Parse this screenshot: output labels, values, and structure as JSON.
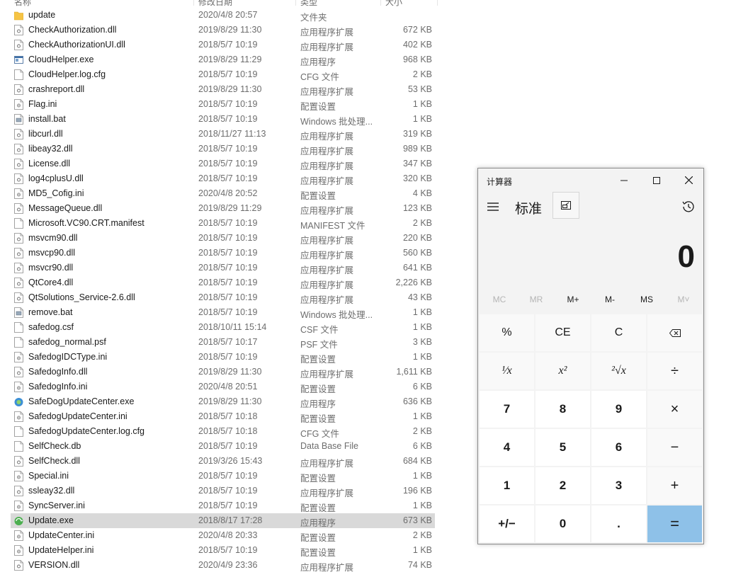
{
  "explorer": {
    "headers": {
      "name": "名称",
      "date": "修改日期",
      "type": "类型",
      "size": "大小"
    },
    "files": [
      {
        "name": "update",
        "date": "2020/4/8 20:57",
        "type": "文件夹",
        "size": "",
        "icon": "folder-icon"
      },
      {
        "name": "CheckAuthorization.dll",
        "date": "2019/8/29 11:30",
        "type": "应用程序扩展",
        "size": "672 KB",
        "icon": "dll-file-icon"
      },
      {
        "name": "CheckAuthorizationUI.dll",
        "date": "2018/5/7 10:19",
        "type": "应用程序扩展",
        "size": "402 KB",
        "icon": "dll-file-icon"
      },
      {
        "name": "CloudHelper.exe",
        "date": "2019/8/29 11:29",
        "type": "应用程序",
        "size": "968 KB",
        "icon": "exe-file-icon"
      },
      {
        "name": "CloudHelper.log.cfg",
        "date": "2018/5/7 10:19",
        "type": "CFG 文件",
        "size": "2 KB",
        "icon": "file-icon"
      },
      {
        "name": "crashreport.dll",
        "date": "2019/8/29 11:30",
        "type": "应用程序扩展",
        "size": "53 KB",
        "icon": "dll-file-icon"
      },
      {
        "name": "Flag.ini",
        "date": "2018/5/7 10:19",
        "type": "配置设置",
        "size": "1 KB",
        "icon": "ini-file-icon"
      },
      {
        "name": "install.bat",
        "date": "2018/5/7 10:19",
        "type": "Windows 批处理...",
        "size": "1 KB",
        "icon": "bat-file-icon"
      },
      {
        "name": "libcurl.dll",
        "date": "2018/11/27 11:13",
        "type": "应用程序扩展",
        "size": "319 KB",
        "icon": "dll-file-icon"
      },
      {
        "name": "libeay32.dll",
        "date": "2018/5/7 10:19",
        "type": "应用程序扩展",
        "size": "989 KB",
        "icon": "dll-file-icon"
      },
      {
        "name": "License.dll",
        "date": "2018/5/7 10:19",
        "type": "应用程序扩展",
        "size": "347 KB",
        "icon": "dll-file-icon"
      },
      {
        "name": "log4cplusU.dll",
        "date": "2018/5/7 10:19",
        "type": "应用程序扩展",
        "size": "320 KB",
        "icon": "dll-file-icon"
      },
      {
        "name": "MD5_Cofig.ini",
        "date": "2020/4/8 20:52",
        "type": "配置设置",
        "size": "4 KB",
        "icon": "ini-file-icon"
      },
      {
        "name": "MessageQueue.dll",
        "date": "2019/8/29 11:29",
        "type": "应用程序扩展",
        "size": "123 KB",
        "icon": "dll-file-icon"
      },
      {
        "name": "Microsoft.VC90.CRT.manifest",
        "date": "2018/5/7 10:19",
        "type": "MANIFEST 文件",
        "size": "2 KB",
        "icon": "file-icon"
      },
      {
        "name": "msvcm90.dll",
        "date": "2018/5/7 10:19",
        "type": "应用程序扩展",
        "size": "220 KB",
        "icon": "dll-file-icon"
      },
      {
        "name": "msvcp90.dll",
        "date": "2018/5/7 10:19",
        "type": "应用程序扩展",
        "size": "560 KB",
        "icon": "dll-file-icon"
      },
      {
        "name": "msvcr90.dll",
        "date": "2018/5/7 10:19",
        "type": "应用程序扩展",
        "size": "641 KB",
        "icon": "dll-file-icon"
      },
      {
        "name": "QtCore4.dll",
        "date": "2018/5/7 10:19",
        "type": "应用程序扩展",
        "size": "2,226 KB",
        "icon": "dll-file-icon"
      },
      {
        "name": "QtSolutions_Service-2.6.dll",
        "date": "2018/5/7 10:19",
        "type": "应用程序扩展",
        "size": "43 KB",
        "icon": "dll-file-icon"
      },
      {
        "name": "remove.bat",
        "date": "2018/5/7 10:19",
        "type": "Windows 批处理...",
        "size": "1 KB",
        "icon": "bat-file-icon"
      },
      {
        "name": "safedog.csf",
        "date": "2018/10/11 15:14",
        "type": "CSF 文件",
        "size": "1 KB",
        "icon": "file-icon"
      },
      {
        "name": "safedog_normal.psf",
        "date": "2018/5/7 10:17",
        "type": "PSF 文件",
        "size": "3 KB",
        "icon": "file-icon"
      },
      {
        "name": "SafedogIDCType.ini",
        "date": "2018/5/7 10:19",
        "type": "配置设置",
        "size": "1 KB",
        "icon": "ini-file-icon"
      },
      {
        "name": "SafedogInfo.dll",
        "date": "2019/8/29 11:30",
        "type": "应用程序扩展",
        "size": "1,611 KB",
        "icon": "dll-file-icon"
      },
      {
        "name": "SafedogInfo.ini",
        "date": "2020/4/8 20:51",
        "type": "配置设置",
        "size": "6 KB",
        "icon": "ini-file-icon"
      },
      {
        "name": "SafeDogUpdateCenter.exe",
        "date": "2019/8/29 11:30",
        "type": "应用程序",
        "size": "636 KB",
        "icon": "safedog-exe-icon"
      },
      {
        "name": "SafedogUpdateCenter.ini",
        "date": "2018/5/7 10:18",
        "type": "配置设置",
        "size": "1 KB",
        "icon": "ini-file-icon"
      },
      {
        "name": "SafedogUpdateCenter.log.cfg",
        "date": "2018/5/7 10:18",
        "type": "CFG 文件",
        "size": "2 KB",
        "icon": "file-icon"
      },
      {
        "name": "SelfCheck.db",
        "date": "2018/5/7 10:19",
        "type": "Data Base File",
        "size": "6 KB",
        "icon": "file-icon"
      },
      {
        "name": "SelfCheck.dll",
        "date": "2019/3/26 15:43",
        "type": "应用程序扩展",
        "size": "684 KB",
        "icon": "dll-file-icon"
      },
      {
        "name": "Special.ini",
        "date": "2018/5/7 10:19",
        "type": "配置设置",
        "size": "1 KB",
        "icon": "ini-file-icon"
      },
      {
        "name": "ssleay32.dll",
        "date": "2018/5/7 10:19",
        "type": "应用程序扩展",
        "size": "196 KB",
        "icon": "dll-file-icon"
      },
      {
        "name": "SyncServer.ini",
        "date": "2018/5/7 10:19",
        "type": "配置设置",
        "size": "1 KB",
        "icon": "ini-file-icon"
      },
      {
        "name": "Update.exe",
        "date": "2018/8/17 17:28",
        "type": "应用程序",
        "size": "673 KB",
        "icon": "update-exe-icon",
        "selected": true
      },
      {
        "name": "UpdateCenter.ini",
        "date": "2020/4/8 20:33",
        "type": "配置设置",
        "size": "2 KB",
        "icon": "ini-file-icon"
      },
      {
        "name": "UpdateHelper.ini",
        "date": "2018/5/7 10:19",
        "type": "配置设置",
        "size": "1 KB",
        "icon": "ini-file-icon"
      },
      {
        "name": "VERSION.dll",
        "date": "2020/4/9 23:36",
        "type": "应用程序扩展",
        "size": "74 KB",
        "icon": "dll-file-icon"
      }
    ]
  },
  "calculator": {
    "window_title": "计算器",
    "mode": "标准",
    "display": "0",
    "memory": [
      {
        "label": "MC",
        "enabled": false
      },
      {
        "label": "MR",
        "enabled": false
      },
      {
        "label": "M+",
        "enabled": true
      },
      {
        "label": "M-",
        "enabled": true
      },
      {
        "label": "MS",
        "enabled": true
      },
      {
        "label": "M˅",
        "enabled": false
      }
    ],
    "keys": [
      [
        "%",
        "CE",
        "C",
        "⌫"
      ],
      [
        "¹⁄x",
        "x²",
        "²√x",
        "÷"
      ],
      [
        "7",
        "8",
        "9",
        "×"
      ],
      [
        "4",
        "5",
        "6",
        "−"
      ],
      [
        "1",
        "2",
        "3",
        "+"
      ],
      [
        "+/−",
        "0",
        ".",
        "="
      ]
    ],
    "colors": {
      "equals_key": "#8ec1e8",
      "number_key": "#ffffff",
      "function_key": "#f9f9f9",
      "selected_row": "#d9d9d9"
    }
  }
}
